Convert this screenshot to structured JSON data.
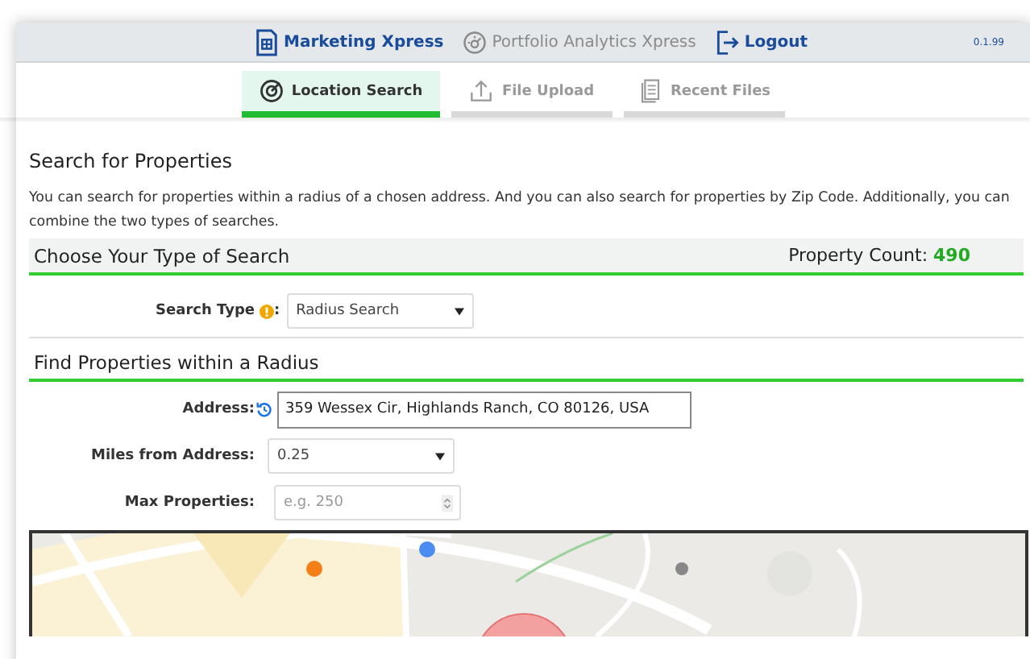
{
  "nav": [
    {
      "label": "Marketing Xpress",
      "kind": "grid",
      "disabled": false
    },
    {
      "label": "Portfolio Analytics Xpress",
      "kind": "gauge",
      "disabled": true
    },
    {
      "label": "Logout",
      "kind": "logout",
      "disabled": false
    }
  ],
  "version": "0.1.99",
  "tabs": [
    {
      "label": "Location Search",
      "kind": "target",
      "selected": true
    },
    {
      "label": "File Upload",
      "kind": "upload",
      "selected": false
    },
    {
      "label": "Recent Files",
      "kind": "files",
      "selected": false
    }
  ],
  "title": "Search for Properties",
  "intro": "You can search for properties within a radius of a chosen address. And you can also search for properties by Zip Code. Additionally, you can combine the two types of searches.",
  "type_section": {
    "title": "Choose Your Type of Search",
    "count_label": "Property Count:",
    "count": "490"
  },
  "search_type": {
    "label": "Search Type",
    "label_suffix": ":",
    "value": "Radius Search"
  },
  "radius_section": {
    "title": "Find Properties within a Radius"
  },
  "fields": [
    {
      "kind": "address",
      "label": "Address:",
      "value": "359 Wessex Cir, Highlands Ranch, CO 80126, USA"
    },
    {
      "kind": "select",
      "label": "Miles from Address:",
      "value": "0.25"
    },
    {
      "kind": "number",
      "label": "Max Properties:",
      "placeholder": "e.g. 250"
    }
  ]
}
